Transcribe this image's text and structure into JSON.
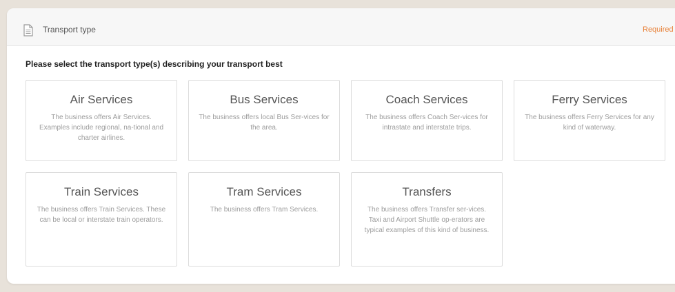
{
  "header": {
    "title": "Transport type",
    "required_label": "Required",
    "icon": "document-icon"
  },
  "prompt": "Please select the transport type(s) describing your transport best",
  "options": [
    {
      "title": "Air Services",
      "description": "The business offers Air Services. Examples include regional, na-tional and charter airlines."
    },
    {
      "title": "Bus Services",
      "description": "The business offers local Bus Ser-vices for the area."
    },
    {
      "title": "Coach Services",
      "description": "The business offers Coach Ser-vices for intrastate and interstate trips."
    },
    {
      "title": "Ferry Services",
      "description": "The business offers Ferry Services for any kind of waterway."
    },
    {
      "title": "Train Services",
      "description": "The business offers Train Services. These can be local or interstate train operators."
    },
    {
      "title": "Tram Services",
      "description": "The business offers Tram Services."
    },
    {
      "title": "Transfers",
      "description": "The business offers Transfer ser-vices. Taxi and Airport Shuttle op-erators are typical examples of this kind of business."
    }
  ],
  "colors": {
    "page_background": "#e8e2da",
    "required_accent": "#e8823a",
    "option_title": "#555555",
    "option_description": "#9c9c9c"
  }
}
